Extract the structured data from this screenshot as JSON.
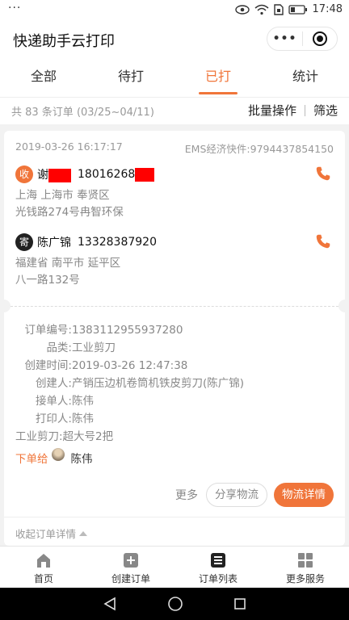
{
  "status_bar": {
    "dots": "···",
    "time": "17:48"
  },
  "app": {
    "title": "快递助手云打印",
    "capsule_more": "•••"
  },
  "tabs": [
    {
      "label": "全部",
      "active": false
    },
    {
      "label": "待打",
      "active": false
    },
    {
      "label": "已打",
      "active": true
    },
    {
      "label": "统计",
      "active": false
    }
  ],
  "filter": {
    "summary": "共 83 条订单 (03/25~04/11)",
    "batch_label": "批量操作",
    "filter_label": "筛选"
  },
  "order": {
    "datetime": "2019-03-26 16:17:17",
    "carrier": "EMS经济快件:9794437854150",
    "receiver": {
      "badge": "收",
      "name_prefix": "谢",
      "phone_visible": "18016268",
      "province_city": "上海 上海市 奉贤区",
      "street": "光钱路274号冉智环保"
    },
    "sender": {
      "badge": "寄",
      "name": "陈广锦",
      "phone": "13328387920",
      "province_city": "福建省 南平市 延平区",
      "street": "八一路132号"
    },
    "details": [
      {
        "key": "订单编号:",
        "value": "1383112955937280"
      },
      {
        "key": "品类:",
        "value": "工业剪刀"
      },
      {
        "key": "创建时间:",
        "value": "2019-03-26 12:47:38"
      },
      {
        "key": "创建人:",
        "value": "产销压边机卷筒机铁皮剪刀(陈广锦)"
      },
      {
        "key": "接单人:",
        "value": "陈伟"
      },
      {
        "key": "打印人:",
        "value": "陈伟"
      }
    ],
    "item_note": "工业剪刀:超大号2把",
    "assign_label": "下单给",
    "assign_to": "陈伟",
    "more_label": "更多",
    "share_label": "分享物流",
    "detail_label": "物流详情",
    "collapse_label": "收起订单详情"
  },
  "bottom_nav": [
    {
      "label": "首页",
      "icon": "home-icon"
    },
    {
      "label": "创建订单",
      "icon": "add-order-icon"
    },
    {
      "label": "订单列表",
      "icon": "order-list-icon"
    },
    {
      "label": "更多服务",
      "icon": "grid-icon"
    }
  ],
  "colors": {
    "accent": "#f0753a",
    "redaction": "#ff0000"
  }
}
